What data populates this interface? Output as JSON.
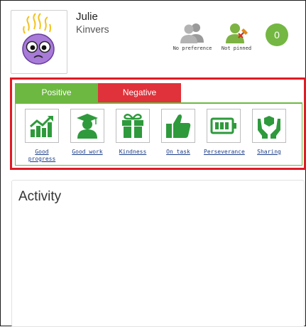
{
  "student": {
    "first_name": "Julie",
    "last_name": "Kinvers"
  },
  "preferences": [
    {
      "label": "No preference",
      "icon": "group-people-icon"
    },
    {
      "label": "Not pinned",
      "icon": "person-pin-icon"
    }
  ],
  "points": {
    "value": "0",
    "color": "#74b743"
  },
  "tabs": {
    "positive": {
      "label": "Positive",
      "color": "#6cb840"
    },
    "negative": {
      "label": "Negative",
      "color": "#e0323a"
    }
  },
  "behaviours": [
    {
      "label": "Good progress",
      "icon": "bar-chart-growth-icon"
    },
    {
      "label": "Good work",
      "icon": "graduate-icon"
    },
    {
      "label": "Kindness",
      "icon": "gift-icon"
    },
    {
      "label": "On task",
      "icon": "thumbs-up-icon"
    },
    {
      "label": "Perseverance",
      "icon": "battery-icon"
    },
    {
      "label": "Sharing",
      "icon": "hands-heart-icon"
    }
  ],
  "activity": {
    "title": "Activity"
  },
  "colors": {
    "highlight": "#e01b24",
    "icon_green": "#2e9a3c"
  }
}
